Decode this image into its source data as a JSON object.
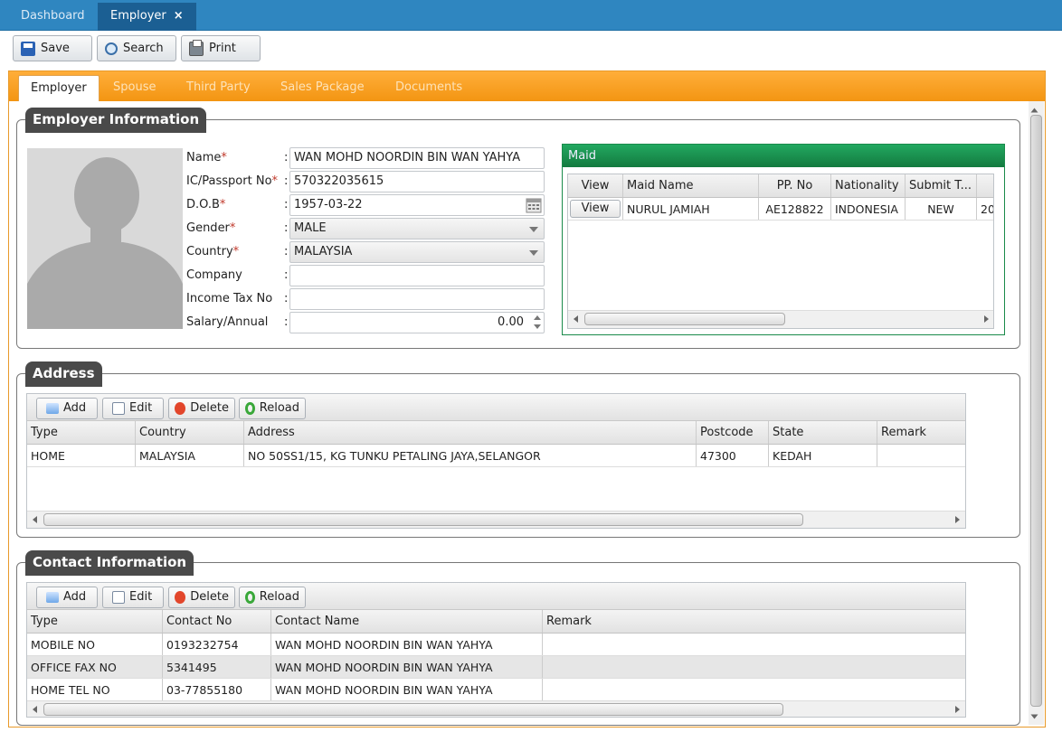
{
  "top_tabs": {
    "dashboard": "Dashboard",
    "employer": "Employer",
    "close": "×"
  },
  "toolbar": {
    "save": "Save",
    "search": "Search",
    "print": "Print"
  },
  "inner_tabs": [
    "Employer",
    "Spouse",
    "Third Party",
    "Sales Package",
    "Documents"
  ],
  "employer_info": {
    "legend": "Employer Information",
    "labels": {
      "name": "Name",
      "ic": "IC/Passport No",
      "dob": "D.O.B",
      "gender": "Gender",
      "country": "Country",
      "company": "Company",
      "income_tax": "Income Tax No",
      "salary": "Salary/Annual"
    },
    "required_mark": "*",
    "colon": ":",
    "values": {
      "name": "WAN MOHD NOORDIN BIN WAN YAHYA",
      "ic": "570322035615",
      "dob": "1957-03-22",
      "gender": "MALE",
      "country": "MALAYSIA",
      "company": "",
      "income_tax": "",
      "salary": "0.00"
    }
  },
  "maid": {
    "title": "Maid",
    "headers": [
      "View",
      "Maid Name",
      "PP. No",
      "Nationality",
      "Submit T..."
    ],
    "rows": [
      {
        "view": "View",
        "name": "NURUL JAMIAH",
        "pp": "AE128822",
        "nationality": "INDONESIA",
        "submit": "NEW",
        "extra": "20"
      }
    ]
  },
  "address": {
    "legend": "Address",
    "buttons": {
      "add": "Add",
      "edit": "Edit",
      "delete": "Delete",
      "reload": "Reload"
    },
    "headers": [
      "Type",
      "Country",
      "Address",
      "Postcode",
      "State",
      "Remark"
    ],
    "rows": [
      {
        "type": "HOME",
        "country": "MALAYSIA",
        "address": "NO 50SS1/15, KG TUNKU PETALING JAYA,SELANGOR",
        "postcode": "47300",
        "state": "KEDAH",
        "remark": ""
      }
    ]
  },
  "contact": {
    "legend": "Contact Information",
    "buttons": {
      "add": "Add",
      "edit": "Edit",
      "delete": "Delete",
      "reload": "Reload"
    },
    "headers": [
      "Type",
      "Contact No",
      "Contact Name",
      "Remark"
    ],
    "rows": [
      {
        "type": "MOBILE NO",
        "no": "0193232754",
        "name": "WAN MOHD NOORDIN BIN WAN YAHYA",
        "remark": ""
      },
      {
        "type": "OFFICE FAX NO",
        "no": "5341495",
        "name": "WAN MOHD NOORDIN BIN WAN YAHYA",
        "remark": ""
      },
      {
        "type": "HOME TEL NO",
        "no": "03-77855180",
        "name": "WAN MOHD NOORDIN BIN WAN YAHYA",
        "remark": ""
      }
    ]
  },
  "colors": {
    "top_bar": "#2f86c0",
    "tab_strip": "#f39512",
    "maid_header": "#1b9353",
    "required": "#c0392b"
  }
}
